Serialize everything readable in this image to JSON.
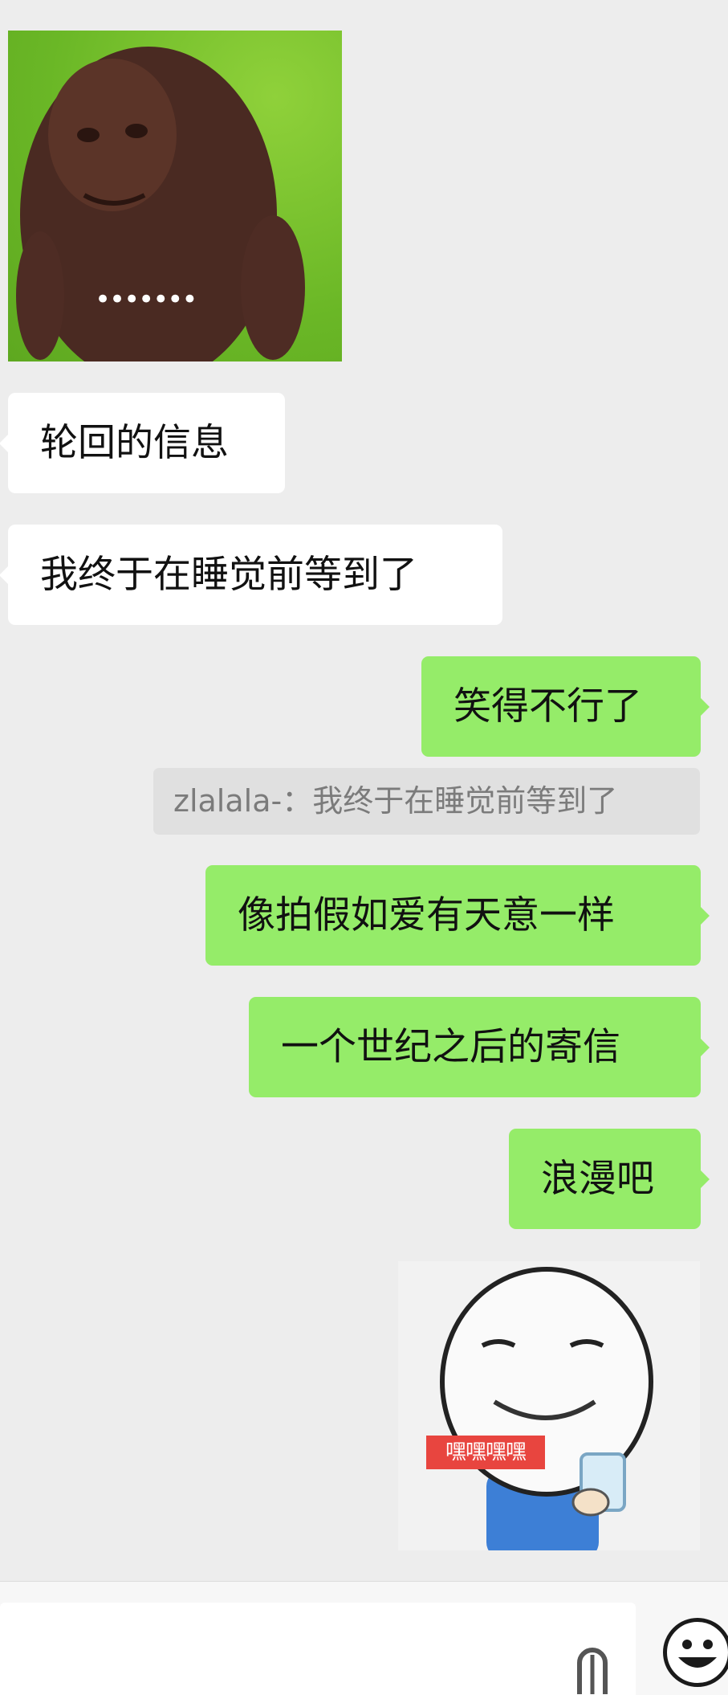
{
  "messages": [
    {
      "side": "in",
      "type": "sticker",
      "overlay_text": "•••••••"
    },
    {
      "side": "in",
      "type": "text",
      "text": "轮回的信息"
    },
    {
      "side": "in",
      "type": "text",
      "text": "我终于在睡觉前等到了"
    },
    {
      "side": "out",
      "type": "text",
      "text": "笑得不行了"
    },
    {
      "side": "out",
      "type": "quote",
      "text": "zlalala-：我终于在睡觉前等到了"
    },
    {
      "side": "out",
      "type": "text",
      "text": "像拍假如爱有天意一样"
    },
    {
      "side": "out",
      "type": "text",
      "text": "一个世纪之后的寄信"
    },
    {
      "side": "out",
      "type": "text",
      "text": "浪漫吧"
    },
    {
      "side": "out",
      "type": "sticker",
      "overlay_text": "嘿嘿嘿嘿"
    }
  ],
  "composer": {
    "input_value": "",
    "icons": [
      "voice-icon",
      "emoji-icon"
    ]
  },
  "colors": {
    "background": "#ededed",
    "incoming_bubble": "#ffffff",
    "outgoing_bubble": "#95ec69",
    "quote_background": "#e0e0e0"
  }
}
